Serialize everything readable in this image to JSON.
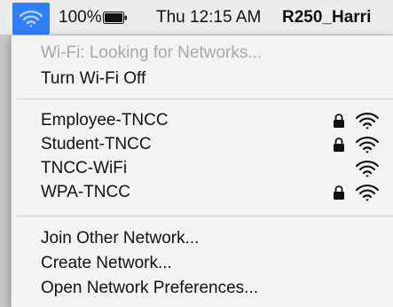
{
  "menubar": {
    "wifi_icon": "wifi-icon",
    "battery_percent": "100%",
    "battery_icon": "battery-full-icon",
    "clock": "Thu 12:15 AM",
    "user": "R250_Harri"
  },
  "menu": {
    "status": "Wi-Fi: Looking for Networks...",
    "toggle": "Turn Wi-Fi Off",
    "networks": [
      {
        "name": "Employee-TNCC",
        "locked": true
      },
      {
        "name": "Student-TNCC",
        "locked": true
      },
      {
        "name": "TNCC-WiFi",
        "locked": false
      },
      {
        "name": "WPA-TNCC",
        "locked": true
      }
    ],
    "actions": {
      "join_other": "Join Other Network...",
      "create": "Create Network...",
      "preferences": "Open Network Preferences..."
    }
  },
  "colors": {
    "accent": "#2f7ff5",
    "menu_bg": "#f3f3f3",
    "disabled_text": "#a8a8a8"
  }
}
